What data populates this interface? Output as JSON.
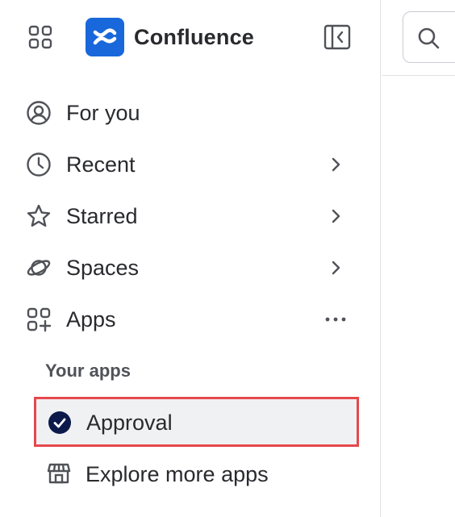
{
  "header": {
    "product_name": "Confluence",
    "app_switcher_icon": "grid-icon",
    "logo_icon": "confluence-logo-icon",
    "collapse_icon": "collapse-sidebar-icon",
    "brand_color": "#1868db"
  },
  "search": {
    "icon": "search-icon"
  },
  "nav": {
    "items": [
      {
        "label": "For you",
        "icon": "user-circle-icon",
        "has_chevron": false
      },
      {
        "label": "Recent",
        "icon": "clock-icon",
        "has_chevron": true
      },
      {
        "label": "Starred",
        "icon": "star-icon",
        "has_chevron": true
      },
      {
        "label": "Spaces",
        "icon": "planet-icon",
        "has_chevron": true
      },
      {
        "label": "Apps",
        "icon": "apps-add-icon",
        "has_more": true
      }
    ]
  },
  "your_apps": {
    "heading": "Your apps",
    "items": [
      {
        "label": "Approval",
        "icon": "check-circle-icon",
        "selected": true,
        "highlight_color": "#e5484d"
      },
      {
        "label": "Explore more apps",
        "icon": "storefront-icon"
      }
    ]
  }
}
